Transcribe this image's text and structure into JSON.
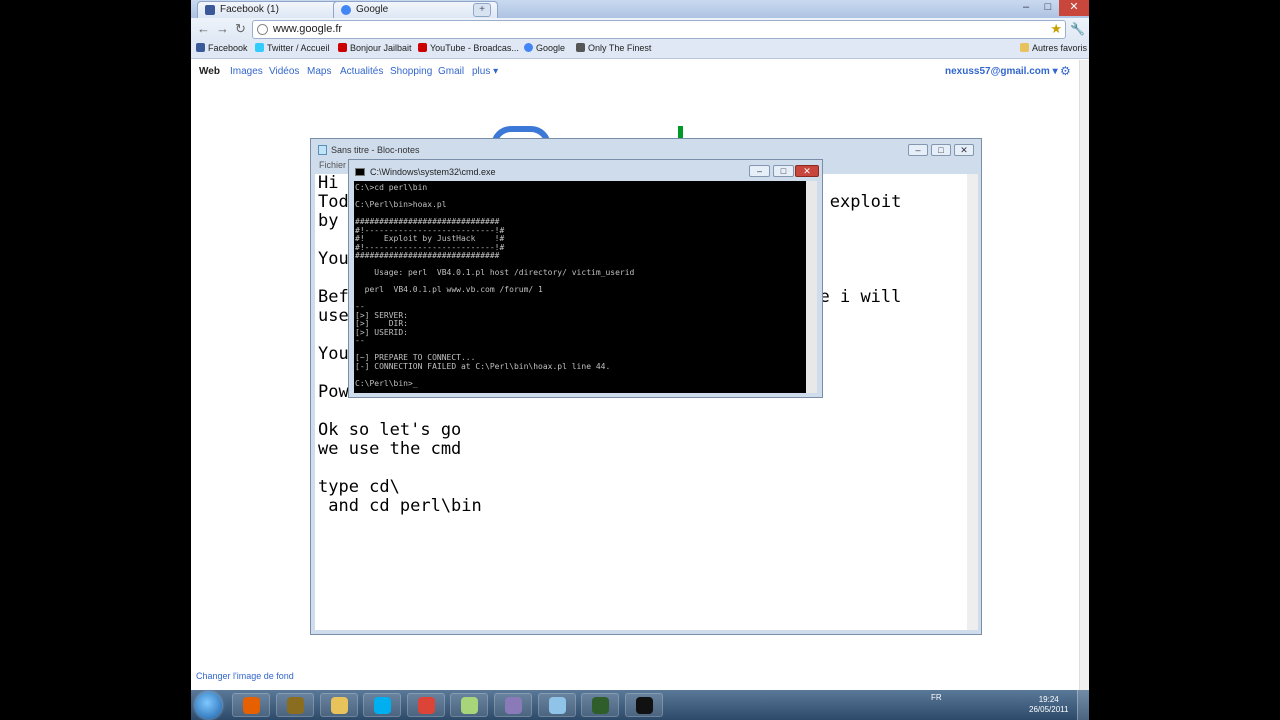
{
  "browser": {
    "tabs": [
      {
        "label": "Facebook (1)",
        "icon": "facebook-icon",
        "color": "#3b5998"
      },
      {
        "label": "Google",
        "icon": "google-icon",
        "color": "#4285f4"
      }
    ],
    "url": "www.google.fr",
    "bookmarks": [
      {
        "label": "Facebook",
        "color": "#3b5998"
      },
      {
        "label": "Twitter / Accueil",
        "color": "#33ccff"
      },
      {
        "label": "Bonjour Jailbait",
        "color": "#cc0000"
      },
      {
        "label": "YouTube - Broadcas...",
        "color": "#cc0000"
      },
      {
        "label": "Google",
        "color": "#4285f4"
      },
      {
        "label": "Only The Finest",
        "color": "#555555"
      }
    ],
    "other_bookmarks": "Autres favoris"
  },
  "google": {
    "nav": [
      "Web",
      "Images",
      "Vidéos",
      "Maps",
      "Actualités",
      "Shopping",
      "Gmail",
      "plus ▾"
    ],
    "account": "nexuss57@gmail.com ▾",
    "change_background": "Changer l'image de fond"
  },
  "notepad": {
    "title": "Sans titre - Bloc-notes",
    "menu": "Fichier",
    "lines": [
      "Hi",
      "Tod                                            .1 exploit",
      "by",
      "",
      "You",
      "",
      "Bef                                           here i will",
      "use",
      "",
      "You",
      "",
      "Pow",
      "",
      "Ok so let's go",
      "we use the cmd",
      "",
      "type cd\\",
      " and cd perl\\bin"
    ]
  },
  "cmd": {
    "title": "C:\\Windows\\system32\\cmd.exe",
    "lines": [
      "C:\\>cd perl\\bin",
      "",
      "C:\\Perl\\bin>hoax.pl",
      "",
      "##############################",
      "#!---------------------------!#",
      "#!    Exploit by JustHack    !#",
      "#!---------------------------!#",
      "##############################",
      "",
      "    Usage: perl  VB4.0.1.pl host /directory/ victim_userid",
      "",
      "  perl  VB4.0.1.pl www.vb.com /forum/ 1",
      "",
      "--",
      "[>] SERVER:",
      "[>]    DIR:",
      "[>] USERID:",
      "--",
      "",
      "[~] PREPARE TO CONNECT...",
      "[-] CONNECTION FAILED at C:\\Perl\\bin\\hoax.pl line 44.",
      "",
      "C:\\Perl\\bin>_"
    ]
  },
  "taskbar": {
    "apps": [
      {
        "icon": "firefox-icon",
        "color": "#e66000"
      },
      {
        "icon": "warcraft-icon",
        "color": "#8a6d1e"
      },
      {
        "icon": "folder-icon",
        "color": "#e8c25a"
      },
      {
        "icon": "skype-icon",
        "color": "#00aff0"
      },
      {
        "icon": "chrome-icon",
        "color": "#db4437"
      },
      {
        "icon": "notepad-icon",
        "color": "#a8d47a"
      },
      {
        "icon": "messenger-icon",
        "color": "#8a7ab8"
      },
      {
        "icon": "app-icon",
        "color": "#8fc4e8"
      },
      {
        "icon": "gamepad-icon",
        "color": "#2f5e2a"
      },
      {
        "icon": "cmd-icon",
        "color": "#111111"
      }
    ],
    "language": "FR",
    "time": "19:24",
    "date": "26/05/2011"
  }
}
